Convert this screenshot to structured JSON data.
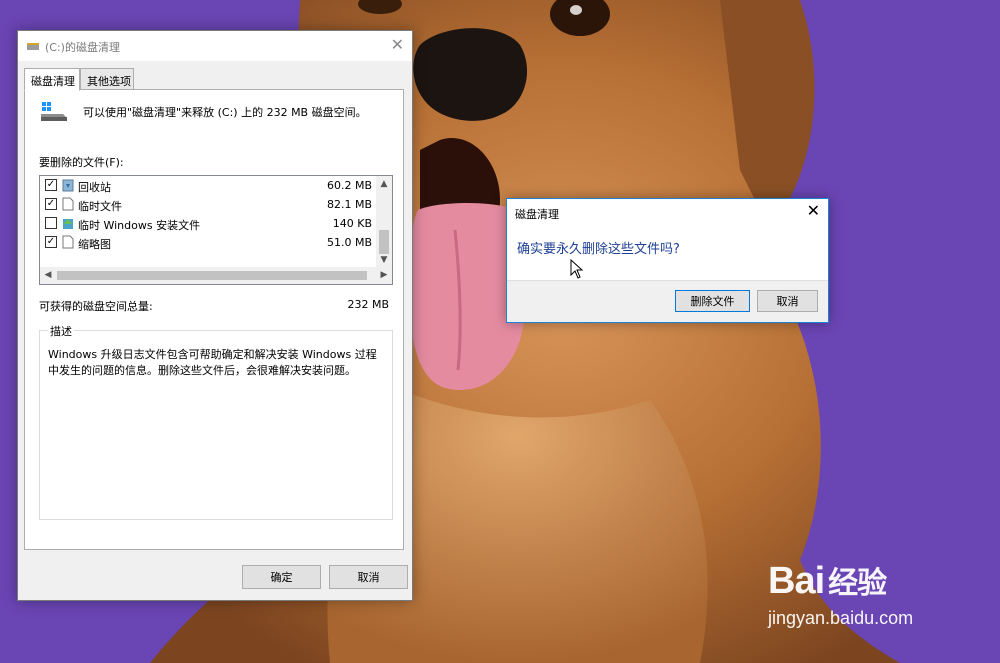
{
  "main_dialog": {
    "title": "(C:)的磁盘清理",
    "tabs": [
      {
        "label": "磁盘清理"
      },
      {
        "label": "其他选项"
      }
    ],
    "summary": "可以使用\"磁盘清理\"来释放  (C:) 上的 232 MB 磁盘空间。",
    "files_label": "要删除的文件(F):",
    "files": [
      {
        "name": "回收站",
        "size": "60.2 MB",
        "checked": true
      },
      {
        "name": "临时文件",
        "size": "82.1 MB",
        "checked": true
      },
      {
        "name": "临时 Windows 安装文件",
        "size": "140 KB",
        "checked": false
      },
      {
        "name": "缩略图",
        "size": "51.0 MB",
        "checked": true
      }
    ],
    "space_label": "可获得的磁盘空间总量:",
    "space_value": "232 MB",
    "description_title": "描述",
    "description_text": "Windows 升级日志文件包含可帮助确定和解决安装 Windows 过程中发生的问题的信息。删除这些文件后，会很难解决安装问题。",
    "ok_label": "确定",
    "cancel_label": "取消"
  },
  "confirm_dialog": {
    "title": "磁盘清理",
    "message": "确实要永久删除这些文件吗?",
    "delete_label": "删除文件",
    "cancel_label": "取消"
  },
  "watermark": {
    "logo_text": "Bai",
    "logo_cn": "经验",
    "url": "jingyan.baidu.com"
  },
  "colors": {
    "wallpaper": "#6a45b4",
    "accent": "#0078d7",
    "message_blue": "#1e3f94"
  }
}
